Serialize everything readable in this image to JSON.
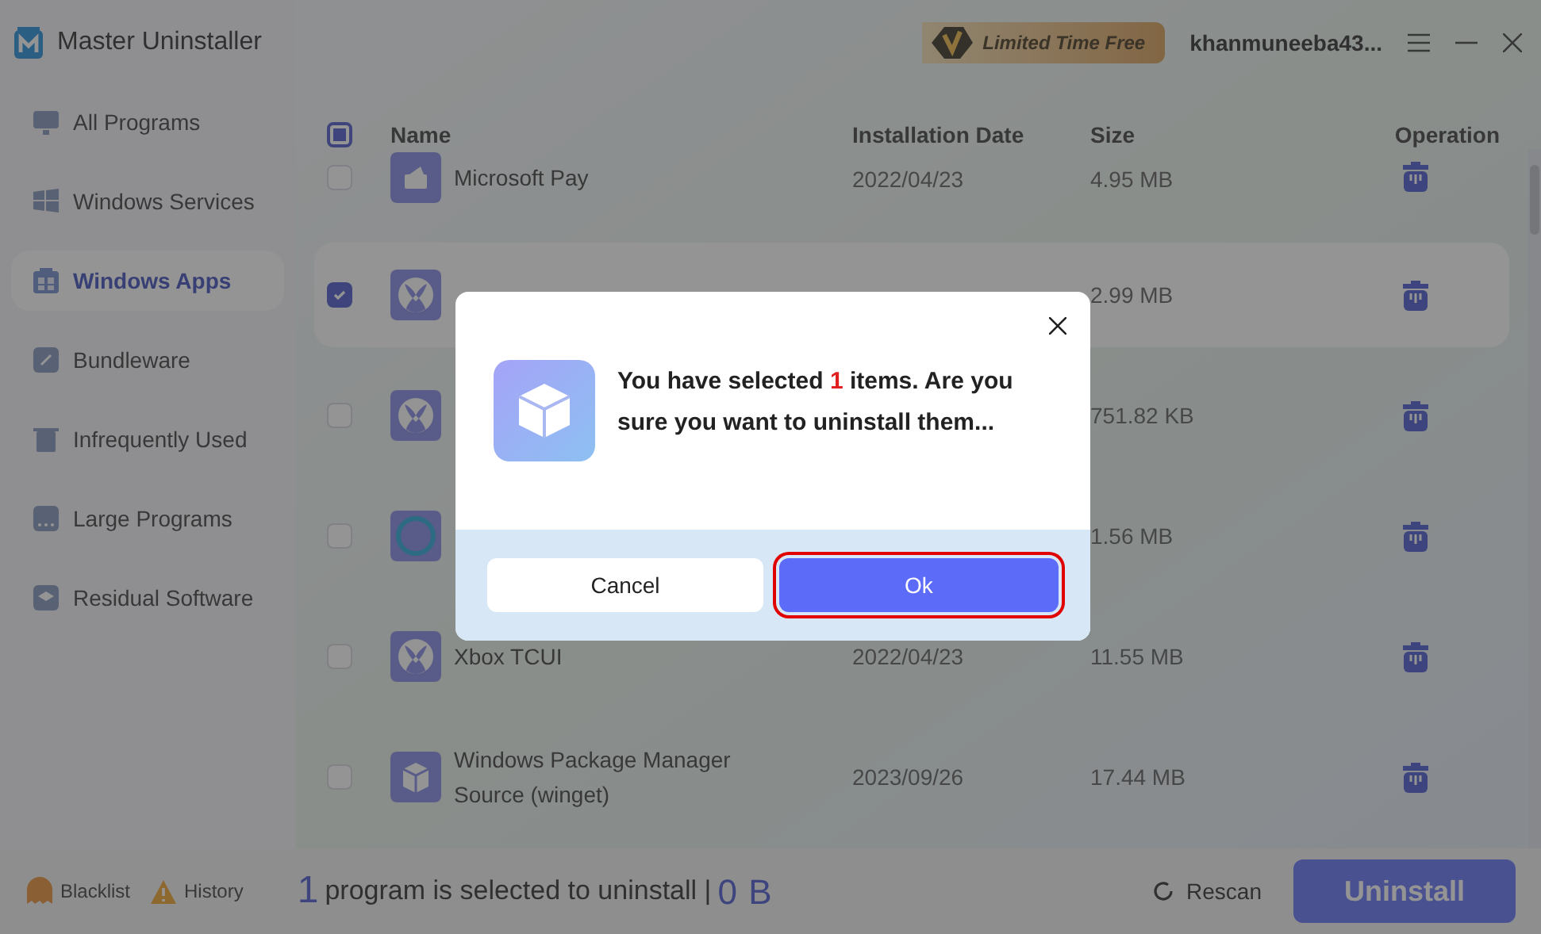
{
  "app": {
    "title": "Master Uninstaller"
  },
  "promo": {
    "label": "Limited Time Free"
  },
  "account": {
    "name": "khanmuneeba43..."
  },
  "sidebar": {
    "items": [
      {
        "label": "All Programs",
        "kind": "monitor",
        "selected": false
      },
      {
        "label": "Windows Services",
        "kind": "windows",
        "selected": false
      },
      {
        "label": "Windows Apps",
        "kind": "apps",
        "selected": true
      },
      {
        "label": "Bundleware",
        "kind": "link",
        "selected": false
      },
      {
        "label": "Infrequently Used",
        "kind": "bin",
        "selected": false
      },
      {
        "label": "Large Programs",
        "kind": "dots",
        "selected": false
      },
      {
        "label": "Residual Software",
        "kind": "layers",
        "selected": false
      }
    ]
  },
  "table": {
    "select_all": {
      "indeterminate": true
    },
    "columns": [
      "Name",
      "Installation Date",
      "Size",
      "Operation"
    ],
    "rows": [
      {
        "name": "Microsoft Pay",
        "date": "2022/04/23",
        "size": "4.95 MB",
        "kind": "wallet",
        "checked": false,
        "selected": false
      },
      {
        "size": "2.99 MB",
        "kind": "xbox",
        "checked": true,
        "selected": true
      },
      {
        "size": "751.82 KB",
        "kind": "xbox",
        "checked": false,
        "selected": false
      },
      {
        "size": "1.56 MB",
        "kind": "ring",
        "checked": false,
        "selected": false
      },
      {
        "name": "Xbox TCUI",
        "date": "2022/04/23",
        "size": "11.55 MB",
        "kind": "xbox",
        "checked": false,
        "selected": false
      },
      {
        "name": "Windows Package Manager Source (winget)",
        "date": "2023/09/26",
        "size": "17.44 MB",
        "kind": "box",
        "checked": false,
        "selected": false
      }
    ]
  },
  "footer": {
    "blacklist": "Blacklist",
    "history": "History",
    "count": "1",
    "message": "program is selected to uninstall |",
    "total": "0 B",
    "rescan": "Rescan",
    "uninstall": "Uninstall"
  },
  "dialog": {
    "message": "You have selected **1** items. Are you sure you want to uninstall them...",
    "cancel": "Cancel",
    "ok": "Ok",
    "ok_highlighted": true
  }
}
